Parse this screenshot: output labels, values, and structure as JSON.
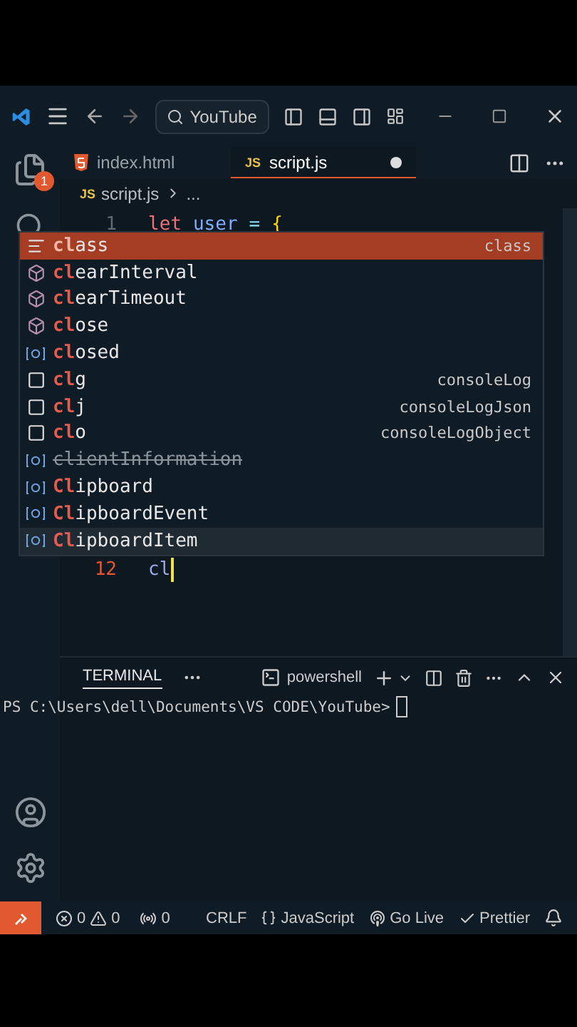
{
  "title_bar": {
    "search": "YouTube"
  },
  "activity_bar": {
    "explorer_badge": "1"
  },
  "tabs": [
    {
      "label": "index.html",
      "kind": "html",
      "selected": false,
      "modified": false
    },
    {
      "label": "script.js",
      "kind": "js",
      "icon_text": "JS",
      "selected": true,
      "modified": true
    }
  ],
  "breadcrumb": {
    "file": "script.js",
    "kind": "js",
    "icon_text": "JS",
    "more": "..."
  },
  "editor": {
    "lines": [
      {
        "number": "1",
        "code": [
          {
            "kind": "keyword",
            "text": "let"
          },
          {
            "kind": "variable",
            "text": "user"
          },
          {
            "kind": "operator",
            "text": "="
          },
          {
            "kind": "bracket",
            "text": "{"
          }
        ],
        "current": false
      },
      {
        "number": "12",
        "code": [
          {
            "kind": "typed",
            "text": "cl"
          }
        ],
        "current": true
      }
    ]
  },
  "suggestions": [
    {
      "kind": "keyword",
      "label": "class",
      "detail": "class",
      "selected": true,
      "hovered": false,
      "deprecated": false
    },
    {
      "kind": "method",
      "label": "clearInterval",
      "selected": false,
      "hovered": false,
      "deprecated": false
    },
    {
      "kind": "method",
      "label": "clearTimeout",
      "selected": false,
      "hovered": false,
      "deprecated": false
    },
    {
      "kind": "method",
      "label": "close",
      "selected": false,
      "hovered": false,
      "deprecated": false
    },
    {
      "kind": "variable",
      "label": "closed",
      "selected": false,
      "hovered": false,
      "deprecated": false
    },
    {
      "kind": "snippet",
      "label": "clg",
      "detail": "consoleLog",
      "selected": false,
      "hovered": false,
      "deprecated": false
    },
    {
      "kind": "snippet",
      "label": "clj",
      "detail": "consoleLogJson",
      "selected": false,
      "hovered": false,
      "deprecated": false
    },
    {
      "kind": "snippet",
      "label": "clo",
      "detail": "consoleLogObject",
      "selected": false,
      "hovered": false,
      "deprecated": false
    },
    {
      "kind": "variable",
      "label": "clientInformation",
      "selected": false,
      "hovered": false,
      "deprecated": true
    },
    {
      "kind": "variable",
      "label": "Clipboard",
      "selected": false,
      "hovered": false,
      "deprecated": false
    },
    {
      "kind": "variable",
      "label": "ClipboardEvent",
      "selected": false,
      "hovered": false,
      "deprecated": false
    },
    {
      "kind": "variable",
      "label": "ClipboardItem",
      "selected": false,
      "hovered": true,
      "deprecated": false
    }
  ],
  "panel": {
    "tab": "TERMINAL",
    "shell": "powershell",
    "prompt": "PS C:\\Users\\dell\\Documents\\VS CODE\\YouTube>"
  },
  "status_bar": {
    "errors": "0",
    "warnings": "0",
    "ports": "0",
    "eol": "CRLF",
    "language": "JavaScript",
    "go_live": "Go Live",
    "prettier": "Prettier"
  }
}
